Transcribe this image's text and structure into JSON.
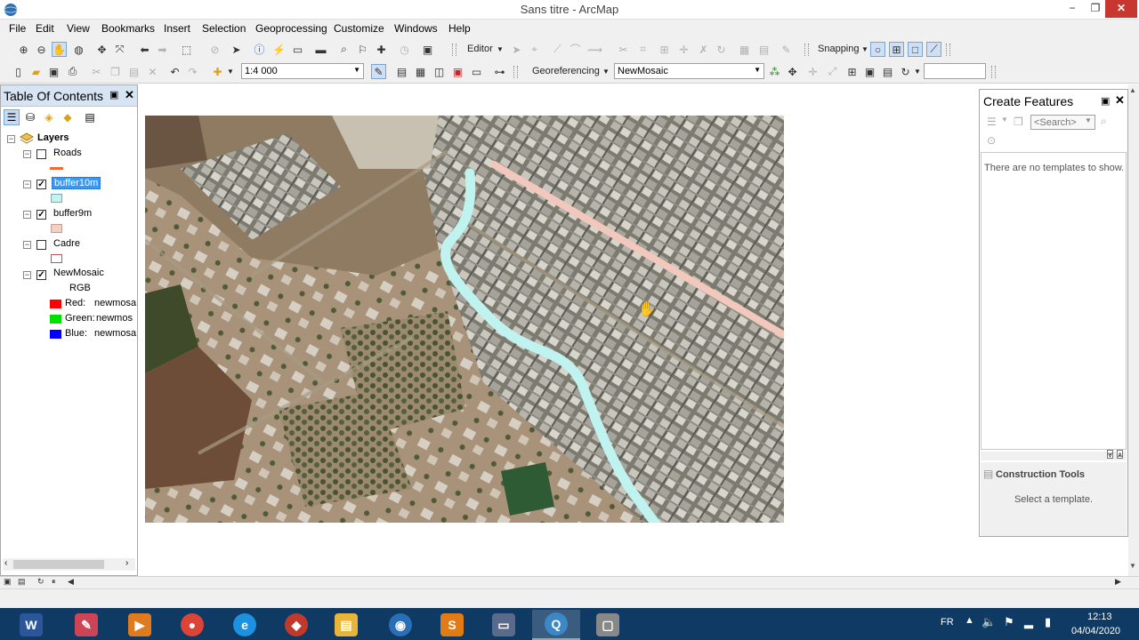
{
  "window": {
    "title": "Sans titre - ArcMap",
    "minimize": "−",
    "maximize": "❐",
    "close": "✕"
  },
  "menu": [
    "File",
    "Edit",
    "View",
    "Bookmarks",
    "Insert",
    "Selection",
    "Geoprocessing",
    "Customize",
    "Windows",
    "Help"
  ],
  "toolbar1": {
    "editor_label": "Editor",
    "snapping_label": "Snapping"
  },
  "toolbar2": {
    "scale_value": "1:4 000",
    "georeferencing_label": "Georeferencing",
    "layer_value": "NewMosaic",
    "find_value": ""
  },
  "toc": {
    "title": "Table Of Contents",
    "pin": "▣",
    "close": "✕",
    "root": "Layers",
    "layers": [
      {
        "name": "Roads",
        "checked": false,
        "symbol": "line",
        "color": "#f06a33"
      },
      {
        "name": "buffer10m",
        "checked": true,
        "selected": true,
        "symbol": "fill",
        "color": "#c3f2ef"
      },
      {
        "name": "buffer9m",
        "checked": true,
        "symbol": "fill",
        "color": "#f3cfc4"
      },
      {
        "name": "Cadre",
        "checked": false,
        "symbol": "fill",
        "color": "#ffffff"
      },
      {
        "name": "NewMosaic",
        "checked": true,
        "symbol": "raster"
      }
    ],
    "raster": {
      "rgb_label": "RGB",
      "bands": [
        {
          "label": "Red:",
          "value": "newmosa",
          "color": "#ff0000"
        },
        {
          "label": "Green:",
          "value": "newmos",
          "color": "#00e000"
        },
        {
          "label": "Blue:",
          "value": "newmosa",
          "color": "#0000ff"
        }
      ]
    },
    "check_mark": "✓",
    "collapse": "−"
  },
  "create_features": {
    "title": "Create Features",
    "pin": "▣",
    "close": "✕",
    "search_placeholder": "<Search>",
    "empty_message": "There are no templates to show.",
    "construction_title": "Construction Tools",
    "construction_message": "Select a template."
  },
  "taskbar": {
    "language": "FR",
    "time": "12:13",
    "date": "04/04/2020",
    "apps": [
      {
        "name": "word",
        "glyph": "W",
        "color": "#2b579a"
      },
      {
        "name": "paint",
        "glyph": "✎",
        "color": "#cc4455"
      },
      {
        "name": "media-player",
        "glyph": "▶",
        "color": "#e07a1f"
      },
      {
        "name": "chrome",
        "glyph": "●",
        "color": "#db4437"
      },
      {
        "name": "internet-explorer",
        "glyph": "e",
        "color": "#1e90e0"
      },
      {
        "name": "pdf-reader",
        "glyph": "◆",
        "color": "#c0392b"
      },
      {
        "name": "file-explorer",
        "glyph": "▤",
        "color": "#e8b43a"
      },
      {
        "name": "google-earth",
        "glyph": "◉",
        "color": "#2a6fb5"
      },
      {
        "name": "sublime-text",
        "glyph": "S",
        "color": "#e07b16"
      },
      {
        "name": "network-app",
        "glyph": "▭",
        "color": "#5a6a8a"
      },
      {
        "name": "arcmap",
        "glyph": "Q",
        "color": "#3a88c8"
      },
      {
        "name": "window-app",
        "glyph": "▢",
        "color": "#888888"
      }
    ]
  }
}
